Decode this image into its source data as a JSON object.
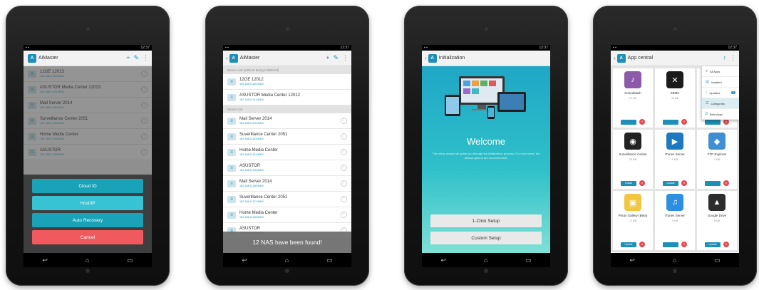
{
  "status": {
    "time": "12:37"
  },
  "screen1": {
    "title": "AiMaster",
    "servers": [
      {
        "name": "12GE 12013",
        "ip": "192.168.0.100:8000"
      },
      {
        "name": "ASUSTOR Media Center 12013",
        "ip": "192.168.0.101:8000"
      },
      {
        "name": "Mail Server 2014",
        "ip": "192.168.0.102:8000"
      },
      {
        "name": "Surveillance Center 2051",
        "ip": "192.168.0.103:8000"
      },
      {
        "name": "Home Media Center",
        "ip": "192.168.0.104:8000"
      },
      {
        "name": "ASUSTOR",
        "ip": "192.168.0.105:8000"
      }
    ],
    "buttons": {
      "cloud_id": "Cloud ID",
      "host_ip": "Host/IP",
      "auto_recovery": "Auto Recovery",
      "cancel": "Cancel"
    }
  },
  "screen2": {
    "title": "AiMaster",
    "section_recent": "Server List (without being Initialized)",
    "recent": [
      {
        "name": "12GE 12012",
        "ip": "192.168.0.100:8000"
      },
      {
        "name": "ASUSTOR Media Center 12012",
        "ip": "192.168.0.101:8000"
      }
    ],
    "section_list": "Server List",
    "servers": [
      {
        "name": "Mail Server 2014",
        "ip": "192.168.0.102:8000"
      },
      {
        "name": "Suverillance Center 2051",
        "ip": "192.168.0.103:8000"
      },
      {
        "name": "Home Media Center",
        "ip": "192.168.0.104:8000"
      },
      {
        "name": "ASUSTOR",
        "ip": "192.168.0.105:8000"
      },
      {
        "name": "Mail Server 2014",
        "ip": "192.168.0.106:8000"
      },
      {
        "name": "Suverillance Center 2051",
        "ip": "192.168.0.107:8000"
      },
      {
        "name": "Home Media Center",
        "ip": "192.168.0.108:8000"
      },
      {
        "name": "ASUSTOR",
        "ip": "192.168.0.109:8000"
      }
    ],
    "toast": "12 NAS have been found!"
  },
  "screen3": {
    "title": "Initialization",
    "welcome": "Welcome",
    "description": "This setup wizard will guide you through the initialization process. For most users, the default options are recommended.",
    "one_click": "1-Click Setup",
    "custom": "Custom Setup"
  },
  "screen4": {
    "title": "App central",
    "menu": [
      {
        "label": "All Apps",
        "icon": "≡"
      },
      {
        "label": "Installed",
        "icon": "▤"
      },
      {
        "label": "Updates",
        "icon": "↑",
        "count": "3"
      },
      {
        "label": "Categories",
        "icon": "☰",
        "selected": true
      },
      {
        "label": "Beta Apps",
        "icon": "β"
      }
    ],
    "apps": [
      {
        "name": "Soundslash",
        "size": "6.5 MB",
        "color": "#8c5aa8",
        "glyph": "♪",
        "action": "",
        "badge": "0"
      },
      {
        "name": "XBMC",
        "size": "30 MB",
        "color": "#1b1b1b",
        "glyph": "✕",
        "action": "",
        "badge": "0"
      },
      {
        "name": "",
        "size": "",
        "color": "#cccccc",
        "glyph": "",
        "action": "",
        "badge": "0"
      },
      {
        "name": "Surveillance Center",
        "size": "25 MB",
        "color": "#222222",
        "glyph": "◉",
        "action": "Install",
        "badge": "0"
      },
      {
        "name": "iTunes Server",
        "size": "5 MB",
        "color": "#1d7ac0",
        "glyph": "▶",
        "action": "Update",
        "badge": "0"
      },
      {
        "name": "FTP Explorer",
        "size": "2 MB",
        "color": "#3f8fd2",
        "glyph": "◆",
        "action": "",
        "badge": "0"
      },
      {
        "name": "Photo Gallery (Beta)",
        "size": "12 MB",
        "color": "#f2c640",
        "glyph": "▣",
        "action": "Update",
        "badge": "0"
      },
      {
        "name": "iTunes Server",
        "size": "5 MB",
        "color": "#2d8fe0",
        "glyph": "♫",
        "action": "",
        "badge": "0"
      },
      {
        "name": "Google Drive",
        "size": "8 MB",
        "color": "#2d2d2d",
        "glyph": "▲",
        "action": "Update",
        "badge": "0"
      }
    ]
  }
}
